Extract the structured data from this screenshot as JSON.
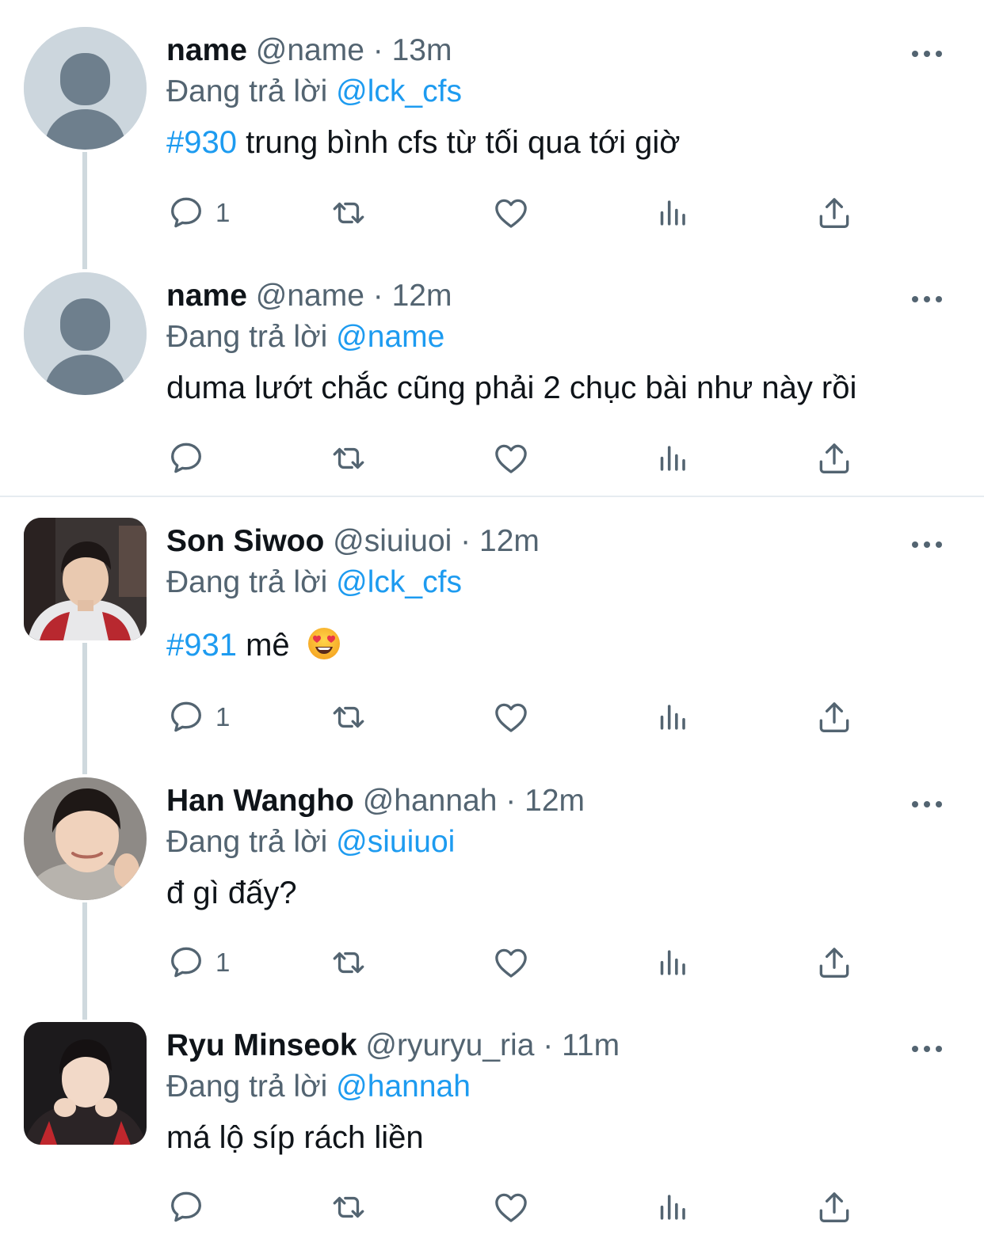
{
  "colors": {
    "link": "#1d9bf0",
    "secondary_text": "#536471",
    "primary_text": "#0f1419",
    "thread_line": "#cfd9de",
    "divider": "#e6ecf0"
  },
  "tweets": [
    {
      "name": "name",
      "handle": "@name",
      "separator": "·",
      "time": "13m",
      "replying_prefix": "Đang trả lời",
      "replying_to": "@lck_cfs",
      "hashtag": "#930",
      "text": "trung bình cfs từ tối qua tới giờ",
      "reply_count": "1",
      "avatar": "default-avatar-icon"
    },
    {
      "name": "name",
      "handle": "@name",
      "separator": "·",
      "time": "12m",
      "replying_prefix": "Đang trả lời",
      "replying_to": "@name",
      "text": "duma lướt chắc cũng phải 2 chục bài như này rồi",
      "reply_count": "",
      "avatar": "default-avatar-icon"
    },
    {
      "name": "Son Siwoo",
      "handle": "@siuiuoi",
      "separator": "·",
      "time": "12m",
      "replying_prefix": "Đang trả lời",
      "replying_to": "@lck_cfs",
      "hashtag": "#931",
      "text": "mê",
      "emoji": "heart-eyes-emoji",
      "reply_count": "1",
      "avatar": "profile-photo"
    },
    {
      "name": "Han Wangho",
      "handle": "@hannah",
      "separator": "·",
      "time": "12m",
      "replying_prefix": "Đang trả lời",
      "replying_to": "@siuiuoi",
      "text": "đ gì đấy?",
      "reply_count": "1",
      "avatar": "profile-photo"
    },
    {
      "name": "Ryu Minseok",
      "handle": "@ryuryu_ria",
      "separator": "·",
      "time": "11m",
      "replying_prefix": "Đang trả lời",
      "replying_to": "@hannah",
      "text": "má lộ síp rách liền",
      "reply_count": "",
      "avatar": "profile-photo"
    }
  ]
}
